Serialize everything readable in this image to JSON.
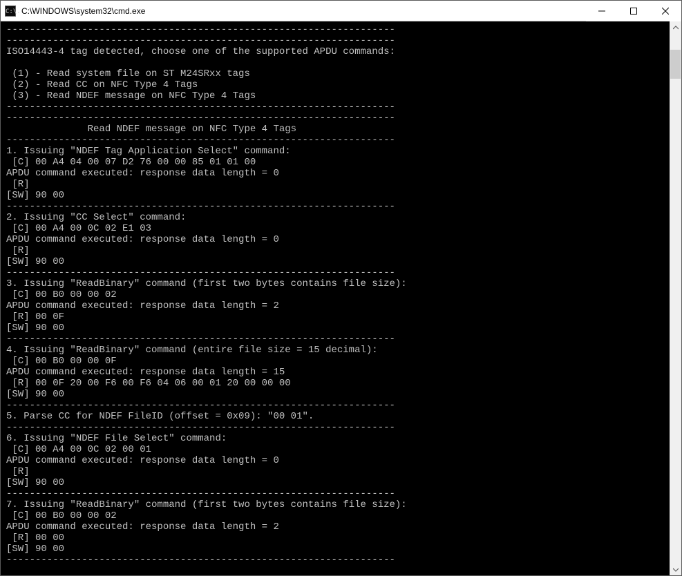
{
  "titlebar": {
    "icon_text": "C:\\.",
    "title": "C:\\WINDOWS\\system32\\cmd.exe"
  },
  "terminal": {
    "dash_line": "-------------------------------------------------------------------",
    "header_detect": "ISO14443-4 tag detected, choose one of the supported APDU commands:",
    "menu": {
      "opt1": " (1) - Read system file on ST M24SRxx tags",
      "opt2": " (2) - Read CC on NFC Type 4 Tags",
      "opt3": " (3) - Read NDEF message on NFC Type 4 Tags"
    },
    "title_ndef": "              Read NDEF message on NFC Type 4 Tags",
    "step1": {
      "head": "1. Issuing \"NDEF Tag Application Select\" command:",
      "c": " [C] 00 A4 04 00 07 D2 76 00 00 85 01 01 00",
      "exec": "APDU command executed: response data length = 0",
      "r": " [R]",
      "sw": "[SW] 90 00"
    },
    "step2": {
      "head": "2. Issuing \"CC Select\" command:",
      "c": " [C] 00 A4 00 0C 02 E1 03",
      "exec": "APDU command executed: response data length = 0",
      "r": " [R]",
      "sw": "[SW] 90 00"
    },
    "step3": {
      "head": "3. Issuing \"ReadBinary\" command (first two bytes contains file size):",
      "c": " [C] 00 B0 00 00 02",
      "exec": "APDU command executed: response data length = 2",
      "r": " [R] 00 0F",
      "sw": "[SW] 90 00"
    },
    "step4": {
      "head": "4. Issuing \"ReadBinary\" command (entire file size = 15 decimal):",
      "c": " [C] 00 B0 00 00 0F",
      "exec": "APDU command executed: response data length = 15",
      "r": " [R] 00 0F 20 00 F6 00 F6 04 06 00 01 20 00 00 00",
      "sw": "[SW] 90 00"
    },
    "step5": {
      "head": "5. Parse CC for NDEF FileID (offset = 0x09): \"00 01\"."
    },
    "step6": {
      "head": "6. Issuing \"NDEF File Select\" command:",
      "c": " [C] 00 A4 00 0C 02 00 01",
      "exec": "APDU command executed: response data length = 0",
      "r": " [R]",
      "sw": "[SW] 90 00"
    },
    "step7": {
      "head": "7. Issuing \"ReadBinary\" command (first two bytes contains file size):",
      "c": " [C] 00 B0 00 00 02",
      "exec": "APDU command executed: response data length = 2",
      "r": " [R] 00 00",
      "sw": "[SW] 90 00"
    }
  }
}
